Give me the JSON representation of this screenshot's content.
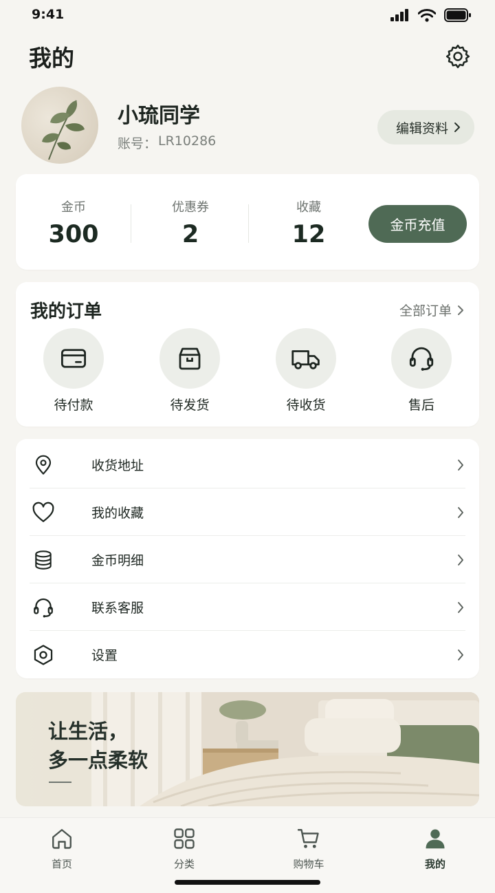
{
  "status_bar": {
    "time": "9:41"
  },
  "header": {
    "title": "我的"
  },
  "profile": {
    "name": "小琉同学",
    "account_label": "账号：",
    "account_id": "LR10286",
    "edit_label": "编辑资料"
  },
  "stats": {
    "items": [
      {
        "label": "金币",
        "value": "300"
      },
      {
        "label": "优惠券",
        "value": "2"
      },
      {
        "label": "收藏",
        "value": "12"
      }
    ],
    "recharge_label": "金币充值"
  },
  "orders": {
    "title": "我的订单",
    "all_label": "全部订单",
    "items": [
      {
        "label": "待付款",
        "icon": "card-icon"
      },
      {
        "label": "待发货",
        "icon": "box-icon"
      },
      {
        "label": "待收货",
        "icon": "truck-icon"
      },
      {
        "label": "售后",
        "icon": "headset-icon"
      }
    ]
  },
  "menu": {
    "items": [
      {
        "label": "收货地址",
        "icon": "location-pin-icon"
      },
      {
        "label": "我的收藏",
        "icon": "heart-icon"
      },
      {
        "label": "金币明细",
        "icon": "coin-stack-icon"
      },
      {
        "label": "联系客服",
        "icon": "headset-icon"
      },
      {
        "label": "设置",
        "icon": "hexagon-settings-icon"
      }
    ]
  },
  "banner": {
    "line1": "让生活，",
    "line2": "多一点柔软"
  },
  "tabbar": {
    "items": [
      {
        "label": "首页",
        "icon": "home-icon"
      },
      {
        "label": "分类",
        "icon": "grid-icon"
      },
      {
        "label": "购物车",
        "icon": "cart-icon"
      },
      {
        "label": "我的",
        "icon": "person-icon",
        "active": true
      }
    ]
  },
  "colors": {
    "accent": "#4f6a55",
    "background": "#f6f5f1",
    "card": "#ffffff"
  }
}
